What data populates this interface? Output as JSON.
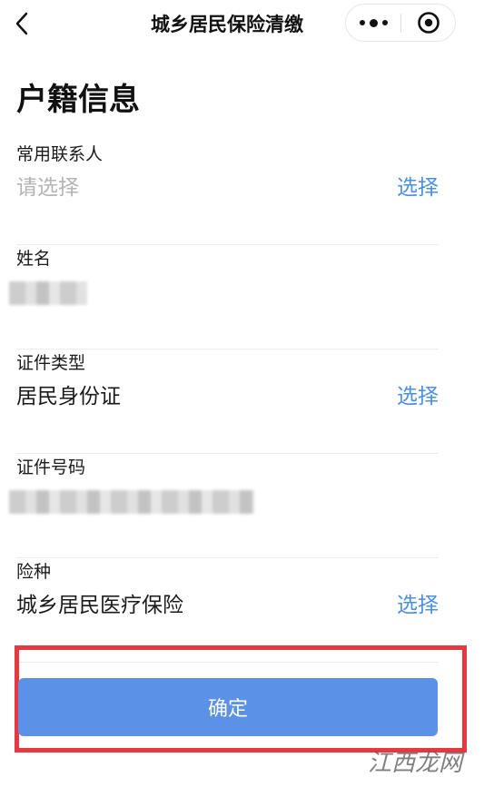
{
  "nav": {
    "title": "城乡居民保险清缴",
    "back_icon": "chevron-left-icon",
    "more_icon": "more-dots-icon",
    "close_icon": "target-circle-icon"
  },
  "section": {
    "title": "户籍信息"
  },
  "fields": {
    "contact": {
      "label": "常用联系人",
      "placeholder": "请选择",
      "action": "选择"
    },
    "name": {
      "label": "姓名",
      "value_state": "redacted"
    },
    "id_type": {
      "label": "证件类型",
      "value": "居民身份证",
      "action": "选择"
    },
    "id_number": {
      "label": "证件号码",
      "value_state": "redacted"
    },
    "insurance": {
      "label": "险种",
      "value": "城乡居民医疗保险",
      "action": "选择"
    }
  },
  "confirm": {
    "label": "确定"
  },
  "watermark": {
    "text": "江西龙网"
  },
  "colors": {
    "accent": "#4a8fe0",
    "button_bg": "#5b92e8",
    "highlight_frame": "#e8383f",
    "placeholder": "#b4b4b4"
  }
}
